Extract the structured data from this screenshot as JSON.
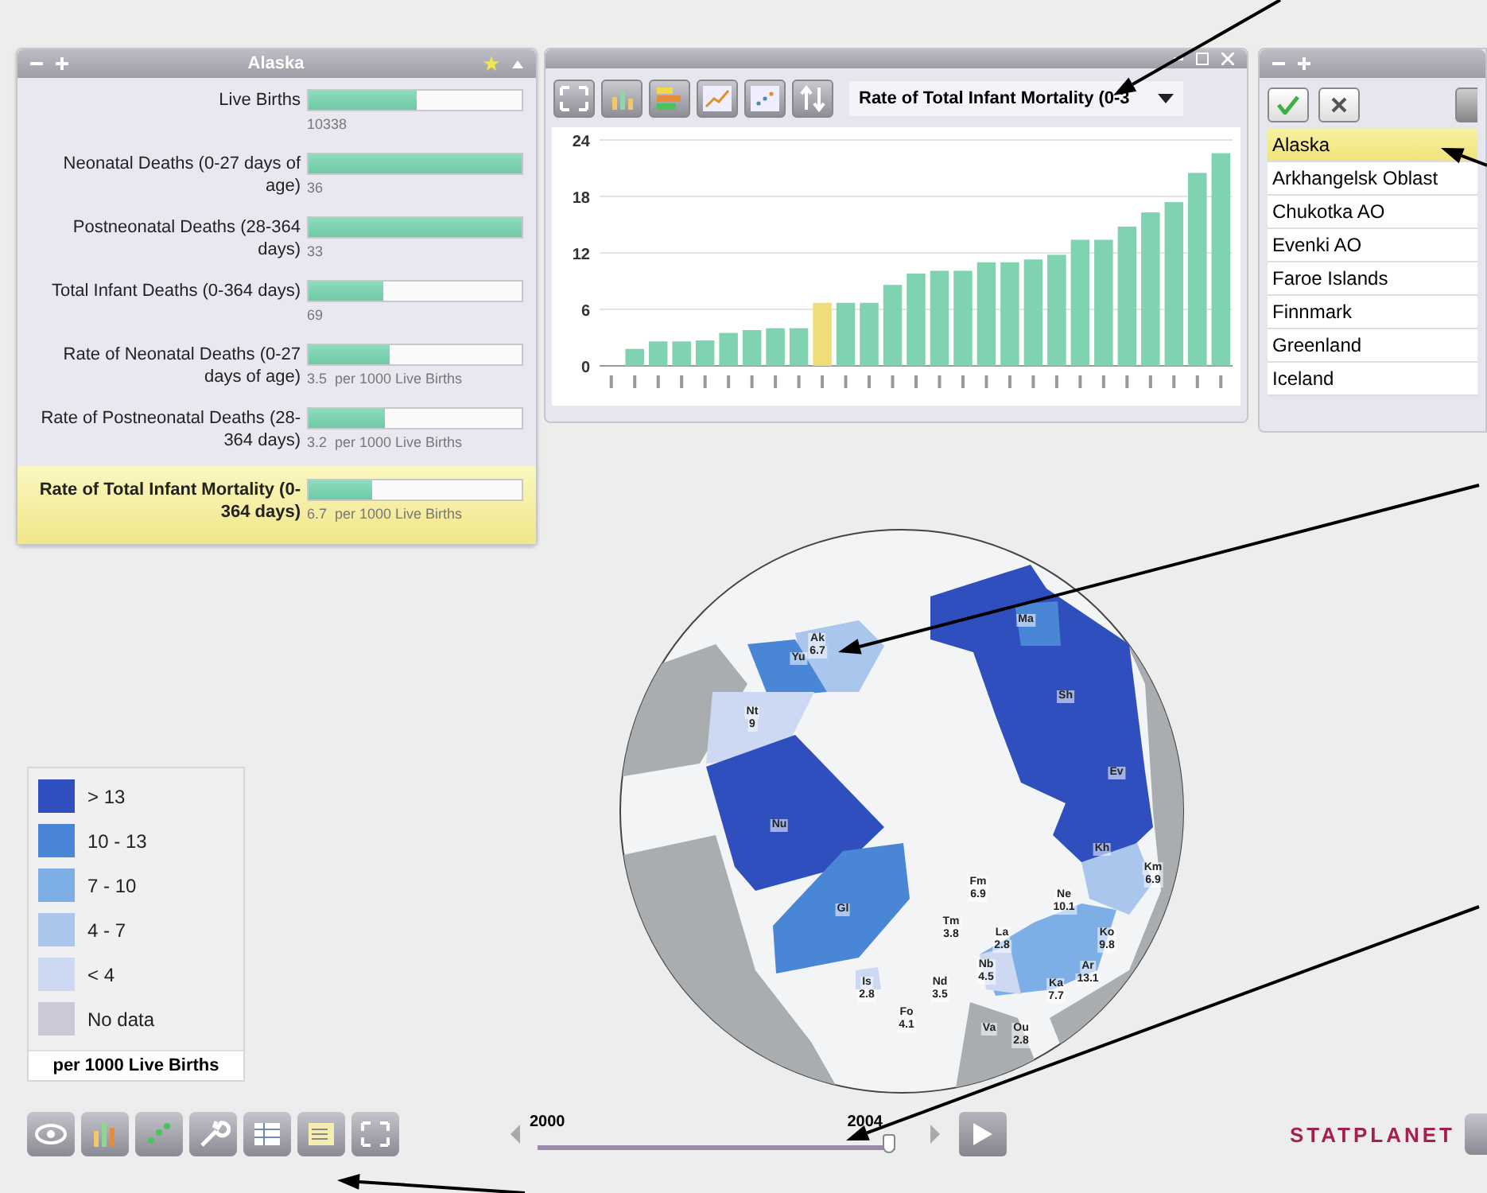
{
  "indicator_panel": {
    "title": "Alaska",
    "rows": [
      {
        "label": "Live Births",
        "value": "10338",
        "level": 0.51,
        "selected": false
      },
      {
        "label": "Neonatal Deaths (0-27 days of age)",
        "value": "36",
        "level": 1,
        "selected": false
      },
      {
        "label": "Postneonatal Deaths (28-364 days)",
        "value": "33",
        "level": 1,
        "selected": false
      },
      {
        "label": "Total Infant Deaths (0-364 days)",
        "value": "69",
        "level": 0.35,
        "selected": false
      },
      {
        "label": "Rate of Neonatal Deaths (0-27 days of age)",
        "value": "3.5",
        "unit": "per 1000 Live Births",
        "level": 0.38,
        "selected": false
      },
      {
        "label": "Rate of Postneonatal Deaths (28-364 days)",
        "value": "3.2",
        "unit": "per 1000 Live Births",
        "level": 0.36,
        "selected": false
      },
      {
        "label": "Rate of Total Infant Mortality (0-364 days)",
        "value": "6.7",
        "unit": "per 1000 Live Births",
        "level": 0.3,
        "selected": true
      }
    ]
  },
  "chart_panel": {
    "indicator": "Rate of Total Infant Mortality (0-3",
    "chart_data": {
      "type": "bar",
      "ylim": [
        0,
        24
      ],
      "yticks": [
        0,
        6,
        12,
        18,
        24
      ],
      "grid": true,
      "series": [
        {
          "color": "#7fd3b0",
          "values": [
            null,
            1.8,
            2.6,
            2.6,
            2.7,
            3.5,
            3.8,
            4.0,
            4.0,
            null,
            6.7,
            6.7,
            8.6,
            9.8,
            10.1,
            10.1,
            11,
            11,
            11.3,
            11.8,
            13.4,
            13.4,
            14.8,
            16.3,
            17.4,
            20.5,
            22.6
          ]
        },
        {
          "color": "#f0dc78",
          "values": [
            null,
            null,
            null,
            null,
            null,
            null,
            null,
            null,
            null,
            6.7,
            null,
            null,
            null,
            null,
            null,
            null,
            null,
            null,
            null,
            null,
            null,
            null,
            null,
            null,
            null,
            null,
            null
          ]
        }
      ]
    }
  },
  "region_list": {
    "items": [
      {
        "label": "Alaska",
        "selected": true
      },
      {
        "label": "Arkhangelsk Oblast",
        "selected": false
      },
      {
        "label": "Chukotka AO",
        "selected": false
      },
      {
        "label": "Evenki AO",
        "selected": false
      },
      {
        "label": "Faroe Islands",
        "selected": false
      },
      {
        "label": "Finnmark",
        "selected": false
      },
      {
        "label": "Greenland",
        "selected": false
      },
      {
        "label": "Iceland",
        "selected": false
      }
    ]
  },
  "map": {
    "regions": [
      {
        "code": "Ma"
      },
      {
        "code": "Ak",
        "value": "6.7"
      },
      {
        "code": "Yu"
      },
      {
        "code": "Sh"
      },
      {
        "code": "Nt",
        "value": "9"
      },
      {
        "code": "Ev"
      },
      {
        "code": "Nu"
      },
      {
        "code": "Kh"
      },
      {
        "code": "Km",
        "value": "6.9"
      },
      {
        "code": "Fm",
        "value": "6.9"
      },
      {
        "code": "Ne",
        "value": "10.1"
      },
      {
        "code": "Gl"
      },
      {
        "code": "Tm",
        "value": "3.8"
      },
      {
        "code": "La",
        "value": "2.8"
      },
      {
        "code": "Ko",
        "value": "9.8"
      },
      {
        "code": "Nb",
        "value": "4.5"
      },
      {
        "code": "Ar",
        "value": "13.1"
      },
      {
        "code": "Is",
        "value": "2.8"
      },
      {
        "code": "Nd",
        "value": "3.5"
      },
      {
        "code": "Ka",
        "value": "7.7"
      },
      {
        "code": "Fo",
        "value": "4.1"
      },
      {
        "code": "Va"
      },
      {
        "code": "Ou",
        "value": "2.8"
      }
    ]
  },
  "legend": {
    "items": [
      {
        "label": "> 13",
        "color": "#2f4fbf"
      },
      {
        "label": "10 - 13",
        "color": "#4a86d6"
      },
      {
        "label": "7 - 10",
        "color": "#7eaee6"
      },
      {
        "label": "4 - 7",
        "color": "#aac6ec"
      },
      {
        "label": "< 4",
        "color": "#cdd9f2"
      },
      {
        "label": "No data",
        "color": "#c9cad6"
      }
    ],
    "unit": "per 1000 Live Births"
  },
  "timeline": {
    "start": "2000",
    "end": "2004",
    "level": 1
  },
  "logo": "STATPLANET"
}
